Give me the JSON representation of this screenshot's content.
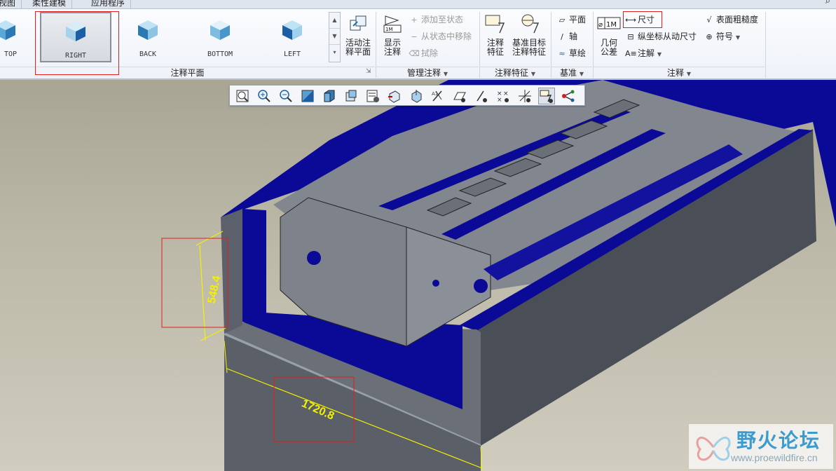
{
  "tabs": [
    "视图",
    "柔性建模",
    "应用程序"
  ],
  "views": {
    "items": [
      {
        "label": "TOP"
      },
      {
        "label": "RIGHT"
      },
      {
        "label": "BACK"
      },
      {
        "label": "BOTTOM"
      },
      {
        "label": "LEFT"
      }
    ],
    "selected": "RIGHT",
    "group_label": "注释平面"
  },
  "manage": {
    "activate": "活动注\n释平面",
    "show": "显示\n注释",
    "add_to_state": "添加至状态",
    "remove_from_state": "从状态中移除",
    "erase": "拭除",
    "group_label": "管理注释"
  },
  "annotation_feature": {
    "annotation_feature": "注释\n特征",
    "datum_target": "基准目标\n注释特征",
    "group_label": "注释特征"
  },
  "datum": {
    "plane": "平面",
    "axis": "轴",
    "sketch": "草绘",
    "group_label": "基准"
  },
  "annotation": {
    "gtol": "几何\n公差",
    "dimension": "尺寸",
    "ordinate_dim": "纵坐标从动尺寸",
    "note": "注解",
    "surface_finish": "表面粗糙度",
    "symbol": "符号",
    "group_label": "注释"
  },
  "model": {
    "dimension_height": "548.4",
    "dimension_length": "1720.8"
  },
  "watermark": {
    "title": "野火论坛",
    "url": "www.proewildfire.cn"
  },
  "colors": {
    "accent_blue": "#0a0a96",
    "model_gray": "#7a7f89",
    "dimension_yellow": "#f4f000",
    "highlight_red": "#e02020"
  }
}
